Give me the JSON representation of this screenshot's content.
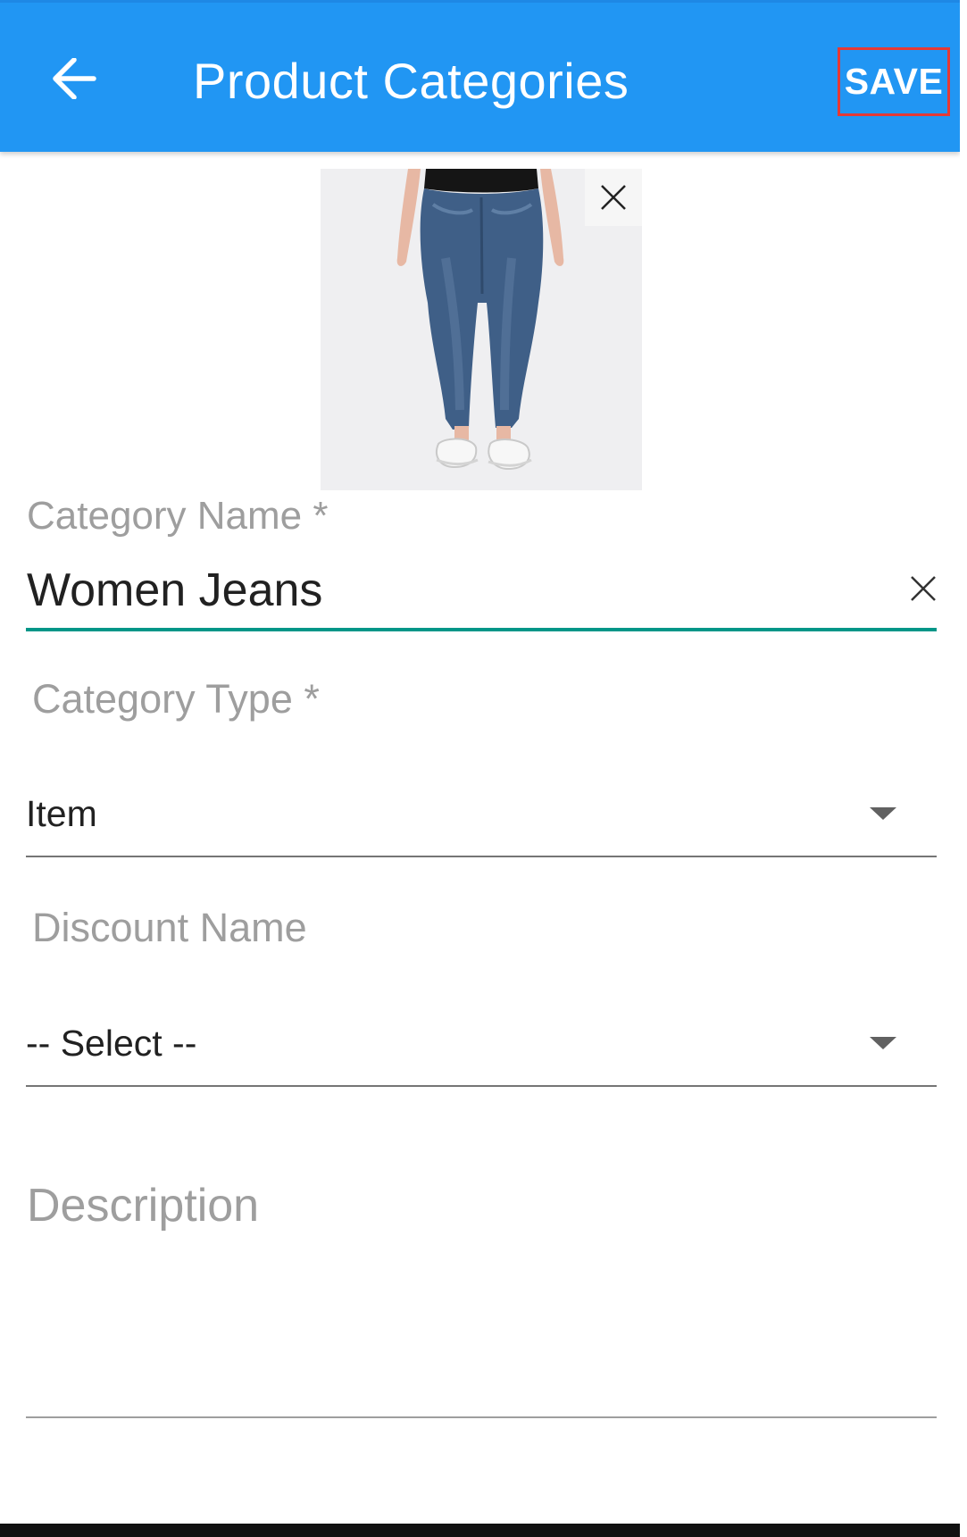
{
  "header": {
    "title": "Product Categories",
    "save_label": "SAVE",
    "back_icon": "arrow-left-icon",
    "background_color": "#2196f3"
  },
  "image": {
    "close_icon": "close-icon"
  },
  "form": {
    "category_name": {
      "label": "Category Name *",
      "value": "Women Jeans",
      "clear_icon": "close-icon",
      "underline_color": "#009688"
    },
    "category_type": {
      "label": "Category Type *",
      "selected": "Item",
      "dropdown_icon": "caret-down-icon"
    },
    "discount_name": {
      "label": "Discount Name",
      "selected": "-- Select --",
      "dropdown_icon": "caret-down-icon"
    },
    "description": {
      "label": "Description",
      "value": ""
    }
  },
  "highlight_color": "#e53935"
}
